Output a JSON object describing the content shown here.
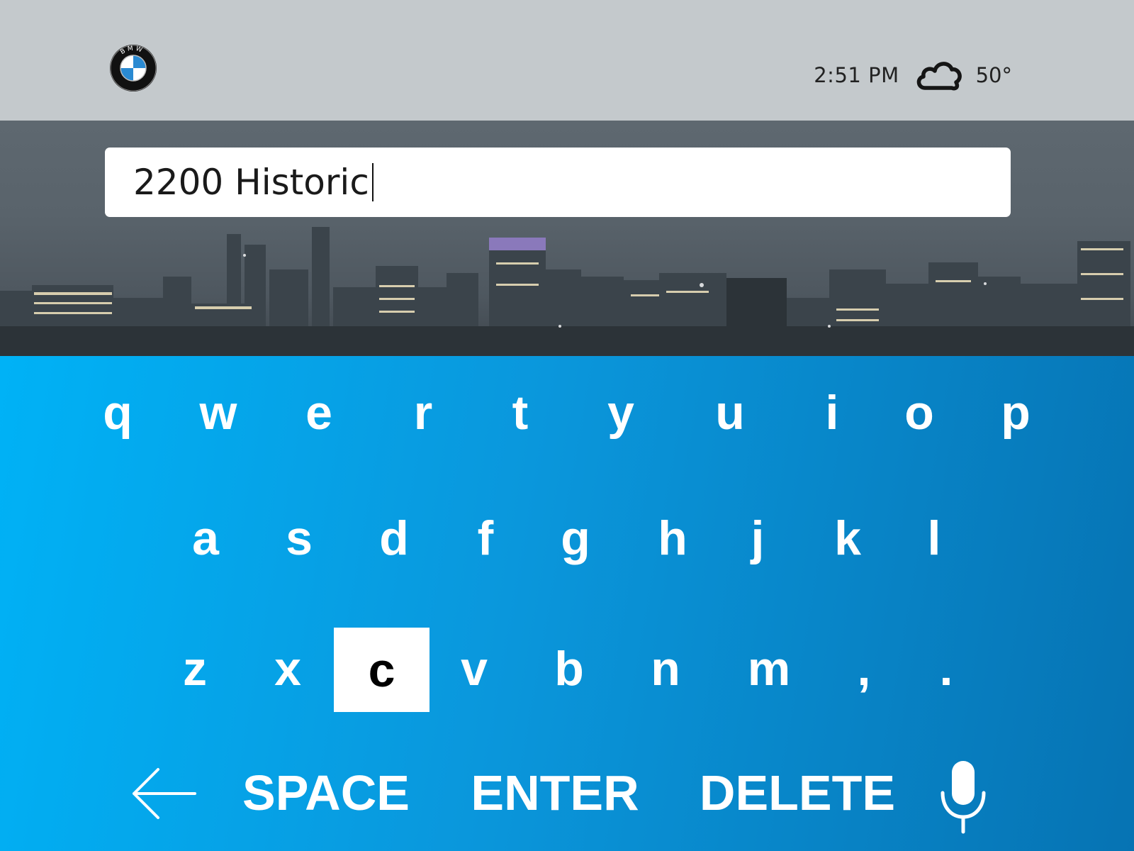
{
  "header": {
    "logo_text": "BMW",
    "time": "2:51 PM",
    "weather_icon": "cloud-icon",
    "temperature": "50°"
  },
  "search": {
    "value": "2200 Historic"
  },
  "keyboard": {
    "rows": [
      [
        "q",
        "w",
        "e",
        "r",
        "t",
        "y",
        "u",
        "i",
        "o",
        "p"
      ],
      [
        "a",
        "s",
        "d",
        "f",
        "g",
        "h",
        "j",
        "k",
        "l"
      ],
      [
        "z",
        "x",
        "c",
        "v",
        "b",
        "n",
        "m",
        ",",
        "."
      ]
    ],
    "active_key": "c",
    "space_label": "SPACE",
    "enter_label": "ENTER",
    "delete_label": "DELETE",
    "back_icon": "back-arrow-icon",
    "mic_icon": "microphone-icon"
  },
  "colors": {
    "topbar": "#c4c9cc",
    "keyboard_start": "#00b2f6",
    "keyboard_end": "#0673b3",
    "key_text": "#ffffff",
    "active_key_bg": "#ffffff"
  }
}
